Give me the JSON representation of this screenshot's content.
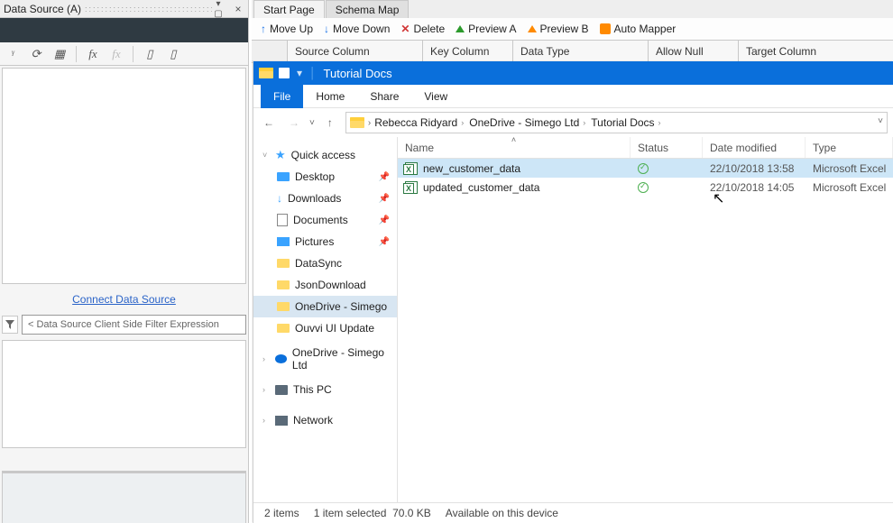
{
  "left": {
    "title": "Data Source (A)",
    "connect_link": "Connect Data Source",
    "filter_placeholder": "< Data Source Client Side Filter Expression"
  },
  "tabs": {
    "start": "Start Page",
    "schema": "Schema Map"
  },
  "schema_toolbar": {
    "moveup": "Move Up",
    "movedown": "Move Down",
    "delete": "Delete",
    "prev_a": "Preview A",
    "prev_b": "Preview B",
    "automap": "Auto Mapper"
  },
  "schema_headers": {
    "source": "Source Column",
    "key": "Key Column",
    "dtype": "Data Type",
    "allownull": "Allow Null",
    "target": "Target Column"
  },
  "explorer": {
    "title": "Tutorial Docs",
    "ribbon": {
      "file": "File",
      "home": "Home",
      "share": "Share",
      "view": "View"
    },
    "breadcrumb": {
      "a": "Rebecca Ridyard",
      "b": "OneDrive - Simego Ltd",
      "c": "Tutorial Docs"
    },
    "sidebar": {
      "quick": "Quick access",
      "desktop": "Desktop",
      "downloads": "Downloads",
      "documents": "Documents",
      "pictures": "Pictures",
      "datasync": "DataSync",
      "jsondl": "JsonDownload",
      "onedrive_sim": "OneDrive - Simego",
      "ouvvi": "Ouvvi UI Update",
      "onedrive2": "OneDrive - Simego Ltd",
      "thispc": "This PC",
      "network": "Network"
    },
    "columns": {
      "name": "Name",
      "status": "Status",
      "date": "Date modified",
      "type": "Type"
    },
    "files": [
      {
        "name": "new_customer_data",
        "date": "22/10/2018 13:58",
        "type": "Microsoft Excel",
        "selected": true
      },
      {
        "name": "updated_customer_data",
        "date": "22/10/2018 14:05",
        "type": "Microsoft Excel",
        "selected": false
      }
    ],
    "status": {
      "items": "2 items",
      "selected": "1 item selected",
      "size": "70.0 KB",
      "avail": "Available on this device"
    }
  }
}
